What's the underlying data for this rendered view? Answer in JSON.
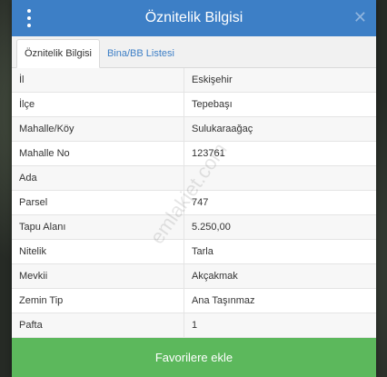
{
  "header": {
    "title": "Öznitelik Bilgisi",
    "close_glyph": "✕"
  },
  "tabs": [
    {
      "label": "Öznitelik Bilgisi"
    },
    {
      "label": "Bina/BB Listesi"
    }
  ],
  "rows": [
    {
      "key": "İl",
      "value": "Eskişehir"
    },
    {
      "key": "İlçe",
      "value": "Tepebaşı"
    },
    {
      "key": "Mahalle/Köy",
      "value": "Sulukaraağaç"
    },
    {
      "key": "Mahalle No",
      "value": "123761"
    },
    {
      "key": "Ada",
      "value": ""
    },
    {
      "key": "Parsel",
      "value": "747"
    },
    {
      "key": "Tapu Alanı",
      "value": "5.250,00"
    },
    {
      "key": "Nitelik",
      "value": "Tarla"
    },
    {
      "key": "Mevkii",
      "value": "Akçakmak"
    },
    {
      "key": "Zemin Tip",
      "value": "Ana Taşınmaz"
    },
    {
      "key": "Pafta",
      "value": "1"
    }
  ],
  "watermark": "emlakjet.com",
  "footer": {
    "button_label": "Favorilere ekle"
  },
  "colors": {
    "header": "#3d7fc6",
    "button": "#5cb85c",
    "tab_link": "#3d7fc6"
  }
}
